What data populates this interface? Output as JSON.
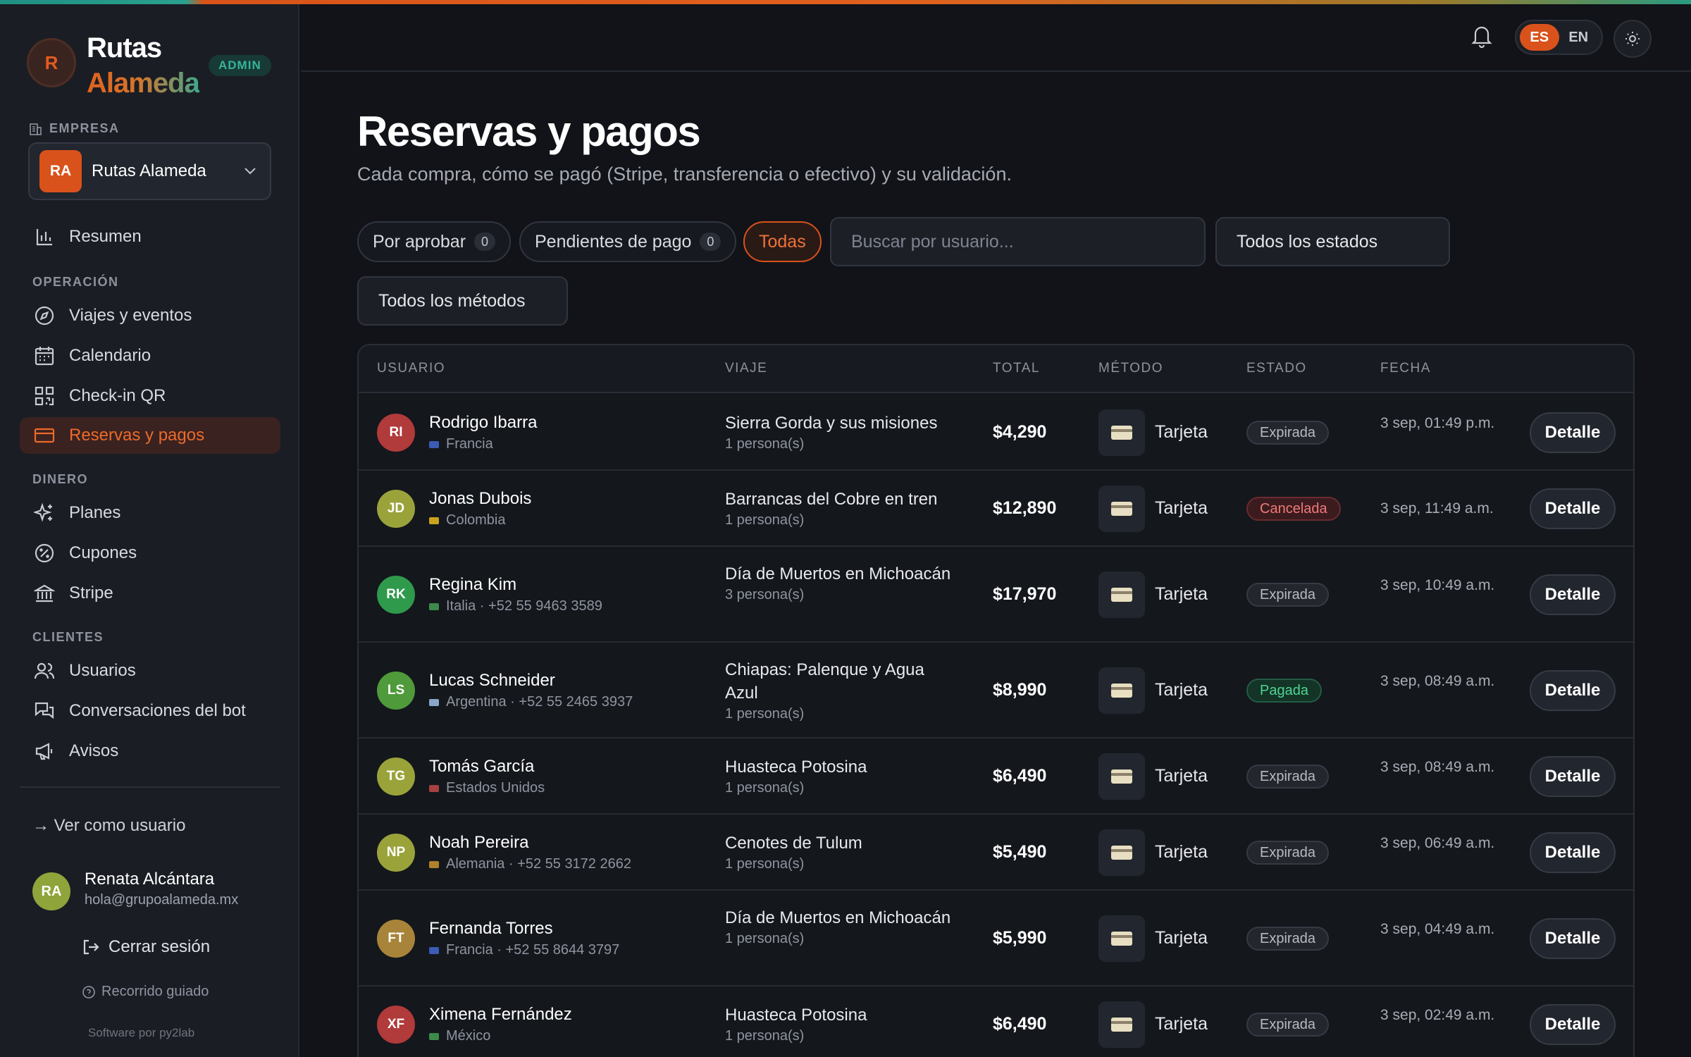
{
  "brand": {
    "mark": "R",
    "line1": "Rutas",
    "line2": "Alameda",
    "badge": "ADMIN"
  },
  "sidebar": {
    "company_label": "EMPRESA",
    "company": {
      "initials": "RA",
      "name": "Rutas Alameda"
    },
    "summary": "Resumen",
    "sections": {
      "operacion": "OPERACIÓN",
      "dinero": "DINERO",
      "clientes": "CLIENTES"
    },
    "items": {
      "viajes": "Viajes y eventos",
      "calendario": "Calendario",
      "checkin": "Check-in QR",
      "reservas": "Reservas y pagos",
      "planes": "Planes",
      "cupones": "Cupones",
      "stripe": "Stripe",
      "usuarios": "Usuarios",
      "conversaciones": "Conversaciones del bot",
      "avisos": "Avisos"
    },
    "view_as": "→ Ver como usuario",
    "user": {
      "initials": "RA",
      "name": "Renata Alcántara",
      "email": "hola@grupoalameda.mx"
    },
    "logout": "Cerrar sesión",
    "tour": "Recorrido guiado",
    "credit": "Software por py2lab"
  },
  "header": {
    "lang_es": "ES",
    "lang_en": "EN"
  },
  "main": {
    "title": "Reservas y pagos",
    "subtitle": "Cada compra, cómo se pagó (Stripe, transferencia o efectivo) y su validación.",
    "filters": {
      "por_aprobar": {
        "label": "Por aprobar",
        "count": "0"
      },
      "pendientes": {
        "label": "Pendientes de pago",
        "count": "0"
      },
      "todas": "Todas",
      "search_placeholder": "Buscar por usuario...",
      "estado_select": "Todos los estados",
      "metodo_select": "Todos los métodos"
    },
    "table": {
      "columns": {
        "usuario": "USUARIO",
        "viaje": "VIAJE",
        "total": "TOTAL",
        "metodo": "MÉTODO",
        "estado": "ESTADO",
        "fecha": "FECHA"
      },
      "detail_label": "Detalle",
      "rows": [
        {
          "initials": "RI",
          "avatar_color": "#b13a3a",
          "name": "Rodrigo Ibarra",
          "meta": "Francia",
          "flag_color": "#3b5bb5",
          "trip": "Sierra Gorda y sus misiones",
          "people": "1 persona(s)",
          "total": "$4,290",
          "method": "Tarjeta",
          "status": "Expirada",
          "status_kind": "expired",
          "date": "3 sep, 01:49 p.m."
        },
        {
          "initials": "JD",
          "avatar_color": "#9aa33a",
          "name": "Jonas Dubois",
          "meta": "Colombia",
          "flag_color": "#c9a21e",
          "trip": "Barrancas del Cobre en tren",
          "people": "1 persona(s)",
          "total": "$12,890",
          "method": "Tarjeta",
          "status": "Cancelada",
          "status_kind": "cancel",
          "date": "3 sep, 11:49 a.m."
        },
        {
          "initials": "RK",
          "avatar_color": "#2f9a4c",
          "name": "Regina Kim",
          "meta": "Italia · +52 55 9463 3589",
          "flag_color": "#3d8a4a",
          "trip": "Día de Muertos en Michoacán",
          "people": "3 persona(s)",
          "total": "$17,970",
          "method": "Tarjeta",
          "status": "Expirada",
          "status_kind": "expired",
          "date": "3 sep, 10:49 a.m."
        },
        {
          "initials": "LS",
          "avatar_color": "#4f9a3a",
          "name": "Lucas Schneider",
          "meta": "Argentina · +52 55 2465 3937",
          "flag_color": "#8aa6c8",
          "trip": "Chiapas: Palenque y Agua Azul",
          "people": "1 persona(s)",
          "total": "$8,990",
          "method": "Tarjeta",
          "status": "Pagada",
          "status_kind": "paid",
          "date": "3 sep, 08:49 a.m."
        },
        {
          "initials": "TG",
          "avatar_color": "#9aa33a",
          "name": "Tomás García",
          "meta": "Estados Unidos",
          "flag_color": "#a84040",
          "trip": "Huasteca Potosina",
          "people": "1 persona(s)",
          "total": "$6,490",
          "method": "Tarjeta",
          "status": "Expirada",
          "status_kind": "expired",
          "date": "3 sep, 08:49 a.m."
        },
        {
          "initials": "NP",
          "avatar_color": "#9aa33a",
          "name": "Noah Pereira",
          "meta": "Alemania · +52 55 3172 2662",
          "flag_color": "#b0802a",
          "trip": "Cenotes de Tulum",
          "people": "1 persona(s)",
          "total": "$5,490",
          "method": "Tarjeta",
          "status": "Expirada",
          "status_kind": "expired",
          "date": "3 sep, 06:49 a.m."
        },
        {
          "initials": "FT",
          "avatar_color": "#a8843a",
          "name": "Fernanda Torres",
          "meta": "Francia · +52 55 8644 3797",
          "flag_color": "#3b5bb5",
          "trip": "Día de Muertos en Michoacán",
          "people": "1 persona(s)",
          "total": "$5,990",
          "method": "Tarjeta",
          "status": "Expirada",
          "status_kind": "expired",
          "date": "3 sep, 04:49 a.m."
        },
        {
          "initials": "XF",
          "avatar_color": "#b13a3a",
          "name": "Ximena Fernández",
          "meta": "México",
          "flag_color": "#3d8a4a",
          "trip": "Huasteca Potosina",
          "people": "1 persona(s)",
          "total": "$6,490",
          "method": "Tarjeta",
          "status": "Expirada",
          "status_kind": "expired",
          "date": "3 sep, 02:49 a.m."
        }
      ]
    }
  }
}
